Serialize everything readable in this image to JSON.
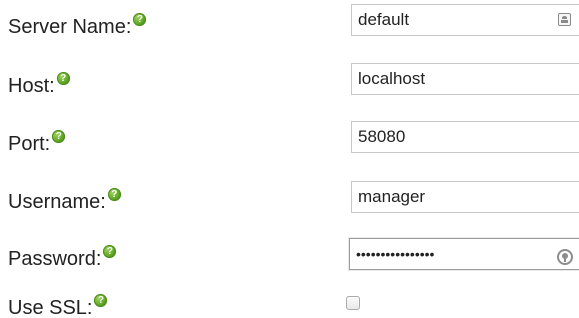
{
  "form": {
    "server_name": {
      "label": "Server Name:",
      "value": "default",
      "field_icon": "contact-card-icon"
    },
    "host": {
      "label": "Host:",
      "value": "localhost"
    },
    "port": {
      "label": "Port:",
      "value": "58080"
    },
    "username": {
      "label": "Username:",
      "value": "manager"
    },
    "password": {
      "label": "Password:",
      "value": "••••••••••••••••",
      "field_icon": "key-icon"
    },
    "use_ssl": {
      "label": "Use SSL:",
      "checked": false
    }
  },
  "help_icon": {
    "glyph": "?",
    "name": "help-icon",
    "color": "#5fa526"
  }
}
